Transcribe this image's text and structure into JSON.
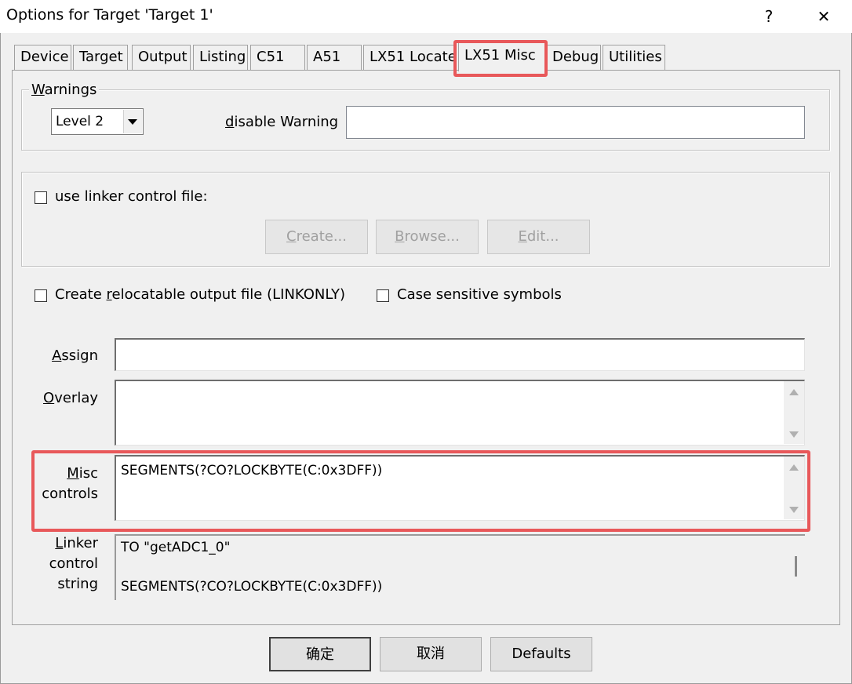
{
  "window": {
    "title": "Options for Target 'Target 1'",
    "help_label": "?",
    "close_label": "✕"
  },
  "tabs": [
    {
      "label": "Device"
    },
    {
      "label": "Target"
    },
    {
      "label": "Output"
    },
    {
      "label": "Listing"
    },
    {
      "label": "C51"
    },
    {
      "label": "A51"
    },
    {
      "label": "LX51 Locate"
    },
    {
      "label": "LX51 Misc",
      "active": true
    },
    {
      "label": "Debug"
    },
    {
      "label": "Utilities"
    }
  ],
  "warnings": {
    "group_label_u": "W",
    "group_label_rest": "arnings",
    "level_value": "Level 2",
    "disable_label_u": "d",
    "disable_label_rest": "isable Warning",
    "disable_value": ""
  },
  "linker_file": {
    "checkbox_label": "use linker control file:",
    "checked": false,
    "create_u": "C",
    "create_rest": "reate...",
    "browse_u": "B",
    "browse_rest": "rowse...",
    "edit_u": "E",
    "edit_rest": "dit..."
  },
  "options": {
    "relocatable_pre": "Create ",
    "relocatable_u": "r",
    "relocatable_rest": "elocatable output file (LINKONLY)",
    "relocatable_checked": false,
    "case_label": "Case sensitive symbols",
    "case_checked": false
  },
  "fields": {
    "assign_u": "A",
    "assign_rest": "ssign",
    "assign_value": "",
    "overlay_u": "O",
    "overlay_rest": "verlay",
    "overlay_value": "",
    "misc_u": "M",
    "misc_rest": "isc",
    "misc_line2": "controls",
    "misc_value": "SEGMENTS(?CO?LOCKBYTE(C:0x3DFF))",
    "linker_u": "L",
    "linker_rest": "inker",
    "linker_line2": "control",
    "linker_line3": "string",
    "linker_line_a": "TO \"getADC1_0\"",
    "linker_line_b": "SEGMENTS(?CO?LOCKBYTE(C:0x3DFF))"
  },
  "footer": {
    "ok_label": "确定",
    "cancel_label": "取消",
    "defaults_label": "Defaults"
  },
  "colors": {
    "highlight": "#e8585a"
  }
}
